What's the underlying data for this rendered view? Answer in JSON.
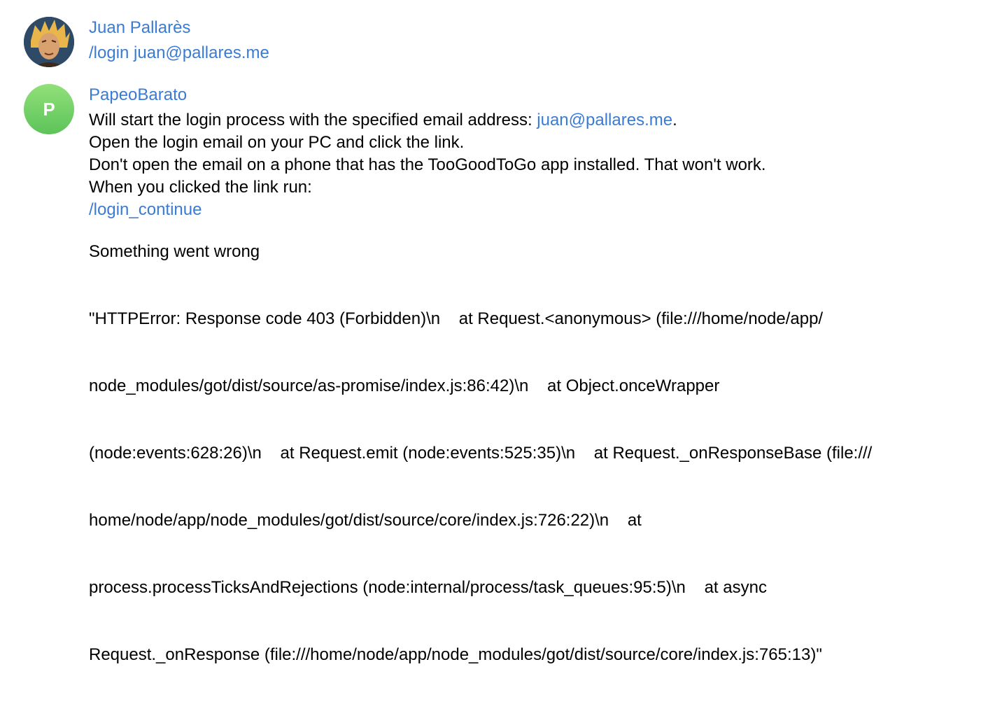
{
  "messages": [
    {
      "sender": "Juan Pallarès",
      "avatar": "photo-avatar",
      "text": "/login juan@pallares.me"
    },
    {
      "sender": "PapeoBarato",
      "avatar_letter": "P",
      "avatar_color": "#5cc35a",
      "intro_before": "Will start the login process with the specified email address: ",
      "email_link": "juan@pallares.me",
      "intro_after": ".",
      "line2": "Open the login email on your PC and click the link.",
      "line3": "Don't open the email on a phone that has the TooGoodToGo app installed. That won't work.",
      "line4": "When you clicked the link run:",
      "command_link": "/login_continue",
      "error_title": "Something went wrong",
      "error_lines": [
        "\"HTTPError: Response code 403 (Forbidden)\\n    at Request.<anonymous> (file:///home/node/app/",
        "node_modules/got/dist/source/as-promise/index.js:86:42)\\n    at Object.onceWrapper",
        "(node:events:628:26)\\n    at Request.emit (node:events:525:35)\\n    at Request._onResponseBase (file:///",
        "home/node/app/node_modules/got/dist/source/core/index.js:726:22)\\n    at",
        "process.processTicksAndRejections (node:internal/process/task_queues:95:5)\\n    at async",
        "Request._onResponse (file:///home/node/app/node_modules/got/dist/source/core/index.js:765:13)\""
      ]
    }
  ],
  "colors": {
    "link": "#3a7bd5",
    "text": "#000000"
  }
}
